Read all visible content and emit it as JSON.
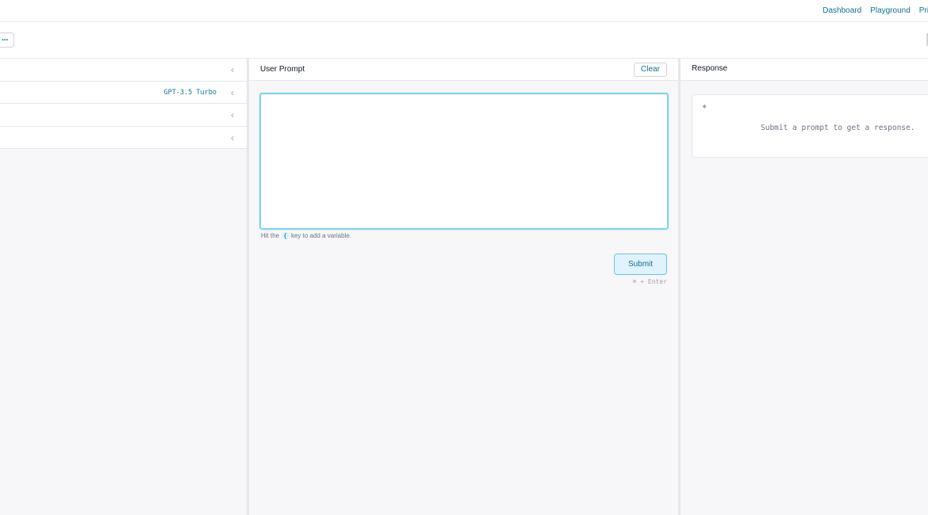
{
  "nav": {
    "links": [
      "Dashboard",
      "Playground",
      "Pric"
    ]
  },
  "toolbar": {
    "more_label": "···"
  },
  "sidebar": {
    "rows": [
      {
        "value": "",
        "chevron": "‹"
      },
      {
        "value": "GPT-3.5 Turbo",
        "chevron": "‹"
      },
      {
        "value": "",
        "chevron": "‹"
      },
      {
        "value": "",
        "chevron": "‹"
      }
    ]
  },
  "prompt": {
    "title": "User Prompt",
    "clear_label": "Clear",
    "value": "",
    "hint_pre": "Hit the",
    "hint_key": "{",
    "hint_post": "key to add a variable.",
    "submit_label": "Submit",
    "shortcut": "⌘ + Enter"
  },
  "response": {
    "title": "Response",
    "sparkle": "✦",
    "placeholder": "Submit a prompt to get a response."
  },
  "colors": {
    "accent": "#0e7490",
    "focus_border": "#7dd3e8",
    "panel_bg": "#f7f7f9"
  }
}
